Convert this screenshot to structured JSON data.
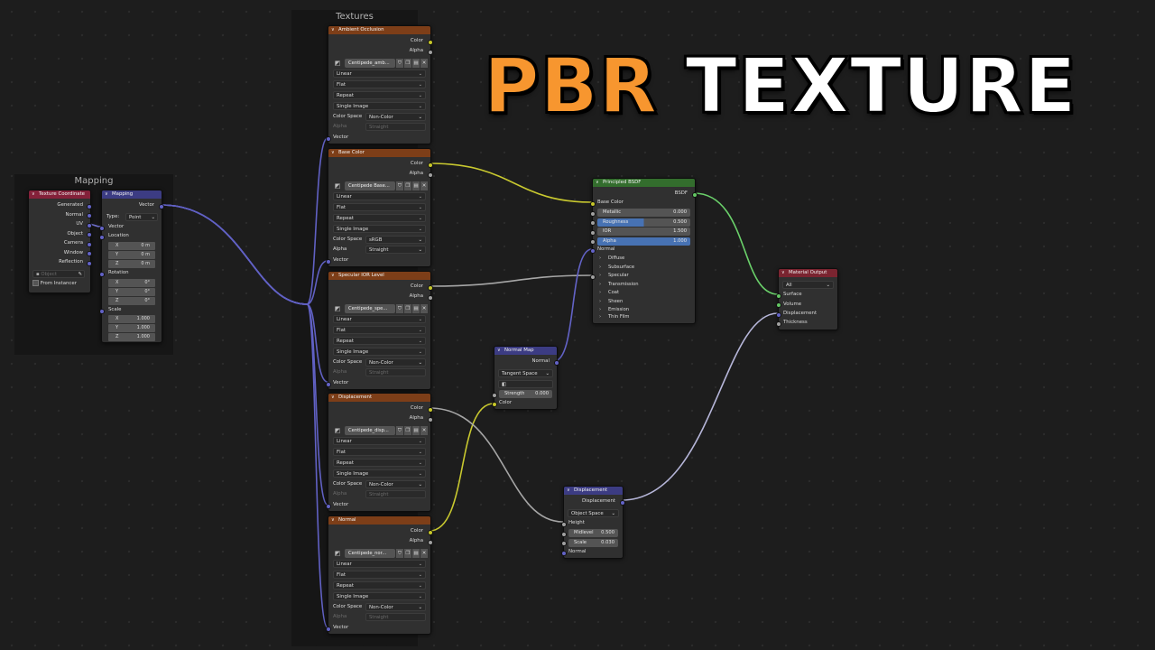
{
  "banner": {
    "word1": "PBR",
    "word2": "TEXTURE",
    "color_orange": "#f7962f"
  },
  "frames": {
    "mapping": "Mapping",
    "textures": "Textures"
  },
  "texture_coordinate": {
    "title": "Texture Coordinate",
    "outputs": [
      "Generated",
      "Normal",
      "UV",
      "Object",
      "Camera",
      "Window",
      "Reflection"
    ],
    "object_placeholder": "Object",
    "from_instancer": "From Instancer"
  },
  "mapping": {
    "title": "Mapping",
    "output": "Vector",
    "type_label": "Type:",
    "type_value": "Point",
    "vector": "Vector",
    "location": "Location",
    "location_vals": [
      [
        "X",
        "0 m"
      ],
      [
        "Y",
        "0 m"
      ],
      [
        "Z",
        "0 m"
      ]
    ],
    "rotation": "Rotation",
    "rotation_vals": [
      [
        "X",
        "0°"
      ],
      [
        "Y",
        "0°"
      ],
      [
        "Z",
        "0°"
      ]
    ],
    "scale": "Scale",
    "scale_vals": [
      [
        "X",
        "1.000"
      ],
      [
        "Y",
        "1.000"
      ],
      [
        "Z",
        "1.000"
      ]
    ]
  },
  "image_nodes": [
    {
      "title": "Ambient Occlusion",
      "image": "Centipede_amb...",
      "interp": "Linear",
      "proj": "Flat",
      "ext": "Repeat",
      "source": "Single Image",
      "cs_label": "Color Space",
      "color_space": "Non-Color",
      "alpha_label": "Alpha",
      "alpha_value": "Straight",
      "color": "Color",
      "alpha": "Alpha",
      "vector": "Vector"
    },
    {
      "title": "Base Color",
      "image": "Centipede Base...",
      "interp": "Linear",
      "proj": "Flat",
      "ext": "Repeat",
      "source": "Single Image",
      "cs_label": "Color Space",
      "color_space": "sRGB",
      "alpha_label": "Alpha",
      "alpha_value": "Straight",
      "color": "Color",
      "alpha": "Alpha",
      "vector": "Vector"
    },
    {
      "title": "Specular IOR Level",
      "image": "Centipede_spe...",
      "interp": "Linear",
      "proj": "Flat",
      "ext": "Repeat",
      "source": "Single Image",
      "cs_label": "Color Space",
      "color_space": "Non-Color",
      "alpha_label": "Alpha",
      "alpha_value": "Straight",
      "color": "Color",
      "alpha": "Alpha",
      "vector": "Vector"
    },
    {
      "title": "Displacement",
      "image": "Centipede_disp...",
      "interp": "Linear",
      "proj": "Flat",
      "ext": "Repeat",
      "source": "Single Image",
      "cs_label": "Color Space",
      "color_space": "Non-Color",
      "alpha_label": "Alpha",
      "alpha_value": "Straight",
      "color": "Color",
      "alpha": "Alpha",
      "vector": "Vector"
    },
    {
      "title": "Normal",
      "image": "Centipede_nor...",
      "interp": "Linear",
      "proj": "Flat",
      "ext": "Repeat",
      "source": "Single Image",
      "cs_label": "Color Space",
      "color_space": "Non-Color",
      "alpha_label": "Alpha",
      "alpha_value": "Straight",
      "color": "Color",
      "alpha": "Alpha",
      "vector": "Vector"
    }
  ],
  "principled": {
    "title": "Principled BSDF",
    "output": "BSDF",
    "base_color": "Base Color",
    "metallic": [
      "Metallic",
      "0.000"
    ],
    "roughness": [
      "Roughness",
      "0.500"
    ],
    "ior": [
      "IOR",
      "1.500"
    ],
    "alpha": [
      "Alpha",
      "1.000"
    ],
    "normal": "Normal",
    "panels": [
      "Diffuse",
      "Subsurface",
      "Specular",
      "Transmission",
      "Coat",
      "Sheen",
      "Emission",
      "Thin Film"
    ]
  },
  "normal_map": {
    "title": "Normal Map",
    "output": "Normal",
    "space": "Tangent Space",
    "strength": [
      "Strength",
      "0.000"
    ],
    "color": "Color"
  },
  "displacement": {
    "title": "Displacement",
    "output": "Displacement",
    "space": "Object Space",
    "height": "Height",
    "midlevel": [
      "Midlevel",
      "0.500"
    ],
    "scale": [
      "Scale",
      "0.030"
    ],
    "normal": "Normal"
  },
  "material_output": {
    "title": "Material Output",
    "target": "All",
    "inputs": [
      "Surface",
      "Volume",
      "Displacement",
      "Thickness"
    ]
  }
}
